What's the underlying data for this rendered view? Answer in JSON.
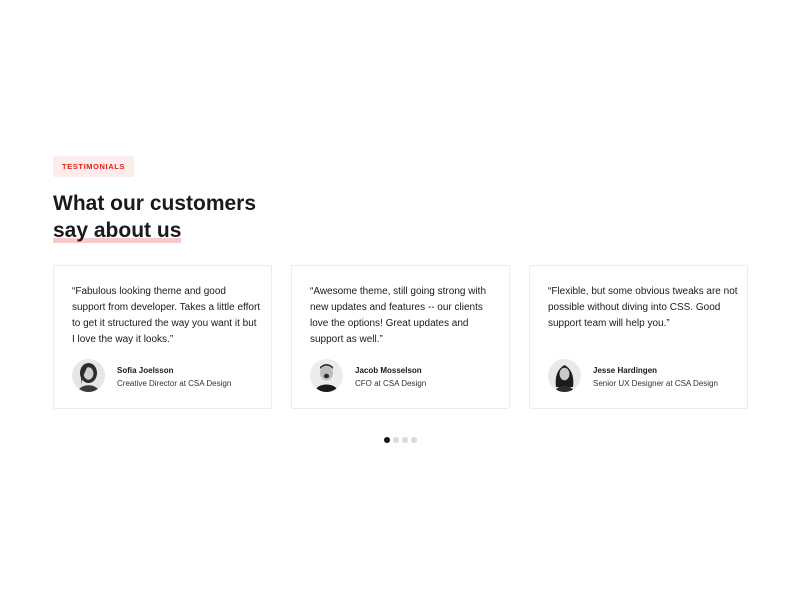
{
  "section": {
    "badge": "TESTIMONIALS",
    "heading_line1": "What our customers",
    "heading_line2": "say about us"
  },
  "testimonials": [
    {
      "quote": "“Fabulous looking theme and good support from developer. Takes a little effort to get it structured the way you want it but I love the way it looks.”",
      "name": "Sofia Joelsson",
      "role": "Creative Director at CSA Design"
    },
    {
      "quote": "“Awesome theme, still going strong with new updates and features -- our clients love the options! Great updates and support as well.”",
      "name": "Jacob Mosselson",
      "role": "CFO at CSA Design"
    },
    {
      "quote": "“Flexible, but some obvious tweaks are not possible without diving into CSS. Good support team will help you.”",
      "name": "Jesse Hardingen",
      "role": "Senior UX Designer at CSA Design"
    }
  ],
  "pagination": {
    "total": 4,
    "active": 1
  },
  "colors": {
    "accent": "#e0251b",
    "badge_bg": "#fdecec",
    "underline": "#f9c9c9",
    "text": "#1a1a1a",
    "dot_active": "#111111",
    "dot_inactive": "#d9d9d9"
  },
  "icons": [
    "avatar-photo"
  ]
}
